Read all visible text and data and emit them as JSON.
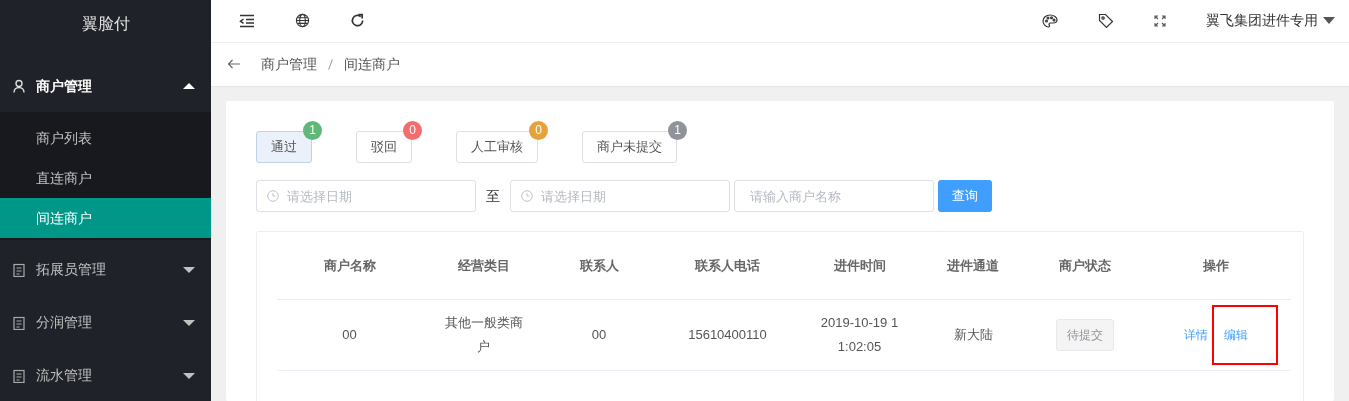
{
  "sidebar": {
    "logo": "翼脸付",
    "menu": [
      {
        "label": "商户管理",
        "expanded": true,
        "children": [
          {
            "label": "商户列表",
            "selected": false
          },
          {
            "label": "直连商户",
            "selected": false
          },
          {
            "label": "间连商户",
            "selected": true
          }
        ]
      },
      {
        "label": "拓展员管理",
        "expanded": false
      },
      {
        "label": "分润管理",
        "expanded": false
      },
      {
        "label": "流水管理",
        "expanded": false
      }
    ]
  },
  "topbar": {
    "user": "翼飞集团进件专用"
  },
  "breadcrumb": [
    "商户管理",
    "间连商户"
  ],
  "status_buttons": [
    {
      "label": "通过",
      "count": "1",
      "color": "#5fb878",
      "selected": true
    },
    {
      "label": "驳回",
      "count": "0",
      "color": "#f56c6c",
      "selected": false
    },
    {
      "label": "人工审核",
      "count": "0",
      "color": "#e6a23c",
      "selected": false
    },
    {
      "label": "商户未提交",
      "count": "1",
      "color": "#909399",
      "selected": false
    }
  ],
  "filters": {
    "start_date": {
      "placeholder": "请选择日期"
    },
    "separator": "至",
    "end_date": {
      "placeholder": "请选择日期"
    },
    "name": {
      "placeholder": "请输入商户名称"
    },
    "query_button": "查询"
  },
  "table": {
    "columns": [
      "商户名称",
      "经营类目",
      "联系人",
      "联系人电话",
      "进件时间",
      "进件通道",
      "商户状态",
      "操作"
    ],
    "rows": [
      {
        "cells": [
          "00",
          "其他一般类商户",
          "00",
          "15610400110",
          "2019-10-19 11:02:05",
          "新大陆"
        ],
        "status": "待提交",
        "actions": [
          {
            "label": "详情",
            "highlighted": false
          },
          {
            "label": "编辑",
            "highlighted": true
          }
        ]
      }
    ]
  }
}
